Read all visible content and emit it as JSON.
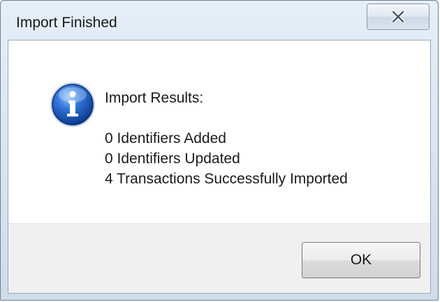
{
  "window": {
    "title": "Import Finished",
    "close_glyph": "X"
  },
  "icons": {
    "close": "close-icon",
    "info": "information-icon"
  },
  "message": {
    "heading": "Import Results:",
    "lines": [
      "0 Identifiers Added",
      "0 Identifiers Updated",
      "4 Transactions Successfully Imported"
    ]
  },
  "footer": {
    "ok_label": "OK"
  },
  "colors": {
    "titlebar_tint": "#d7e3f0",
    "info_blue": "#1f5fbf",
    "footer_bg": "#f0f0f0"
  }
}
